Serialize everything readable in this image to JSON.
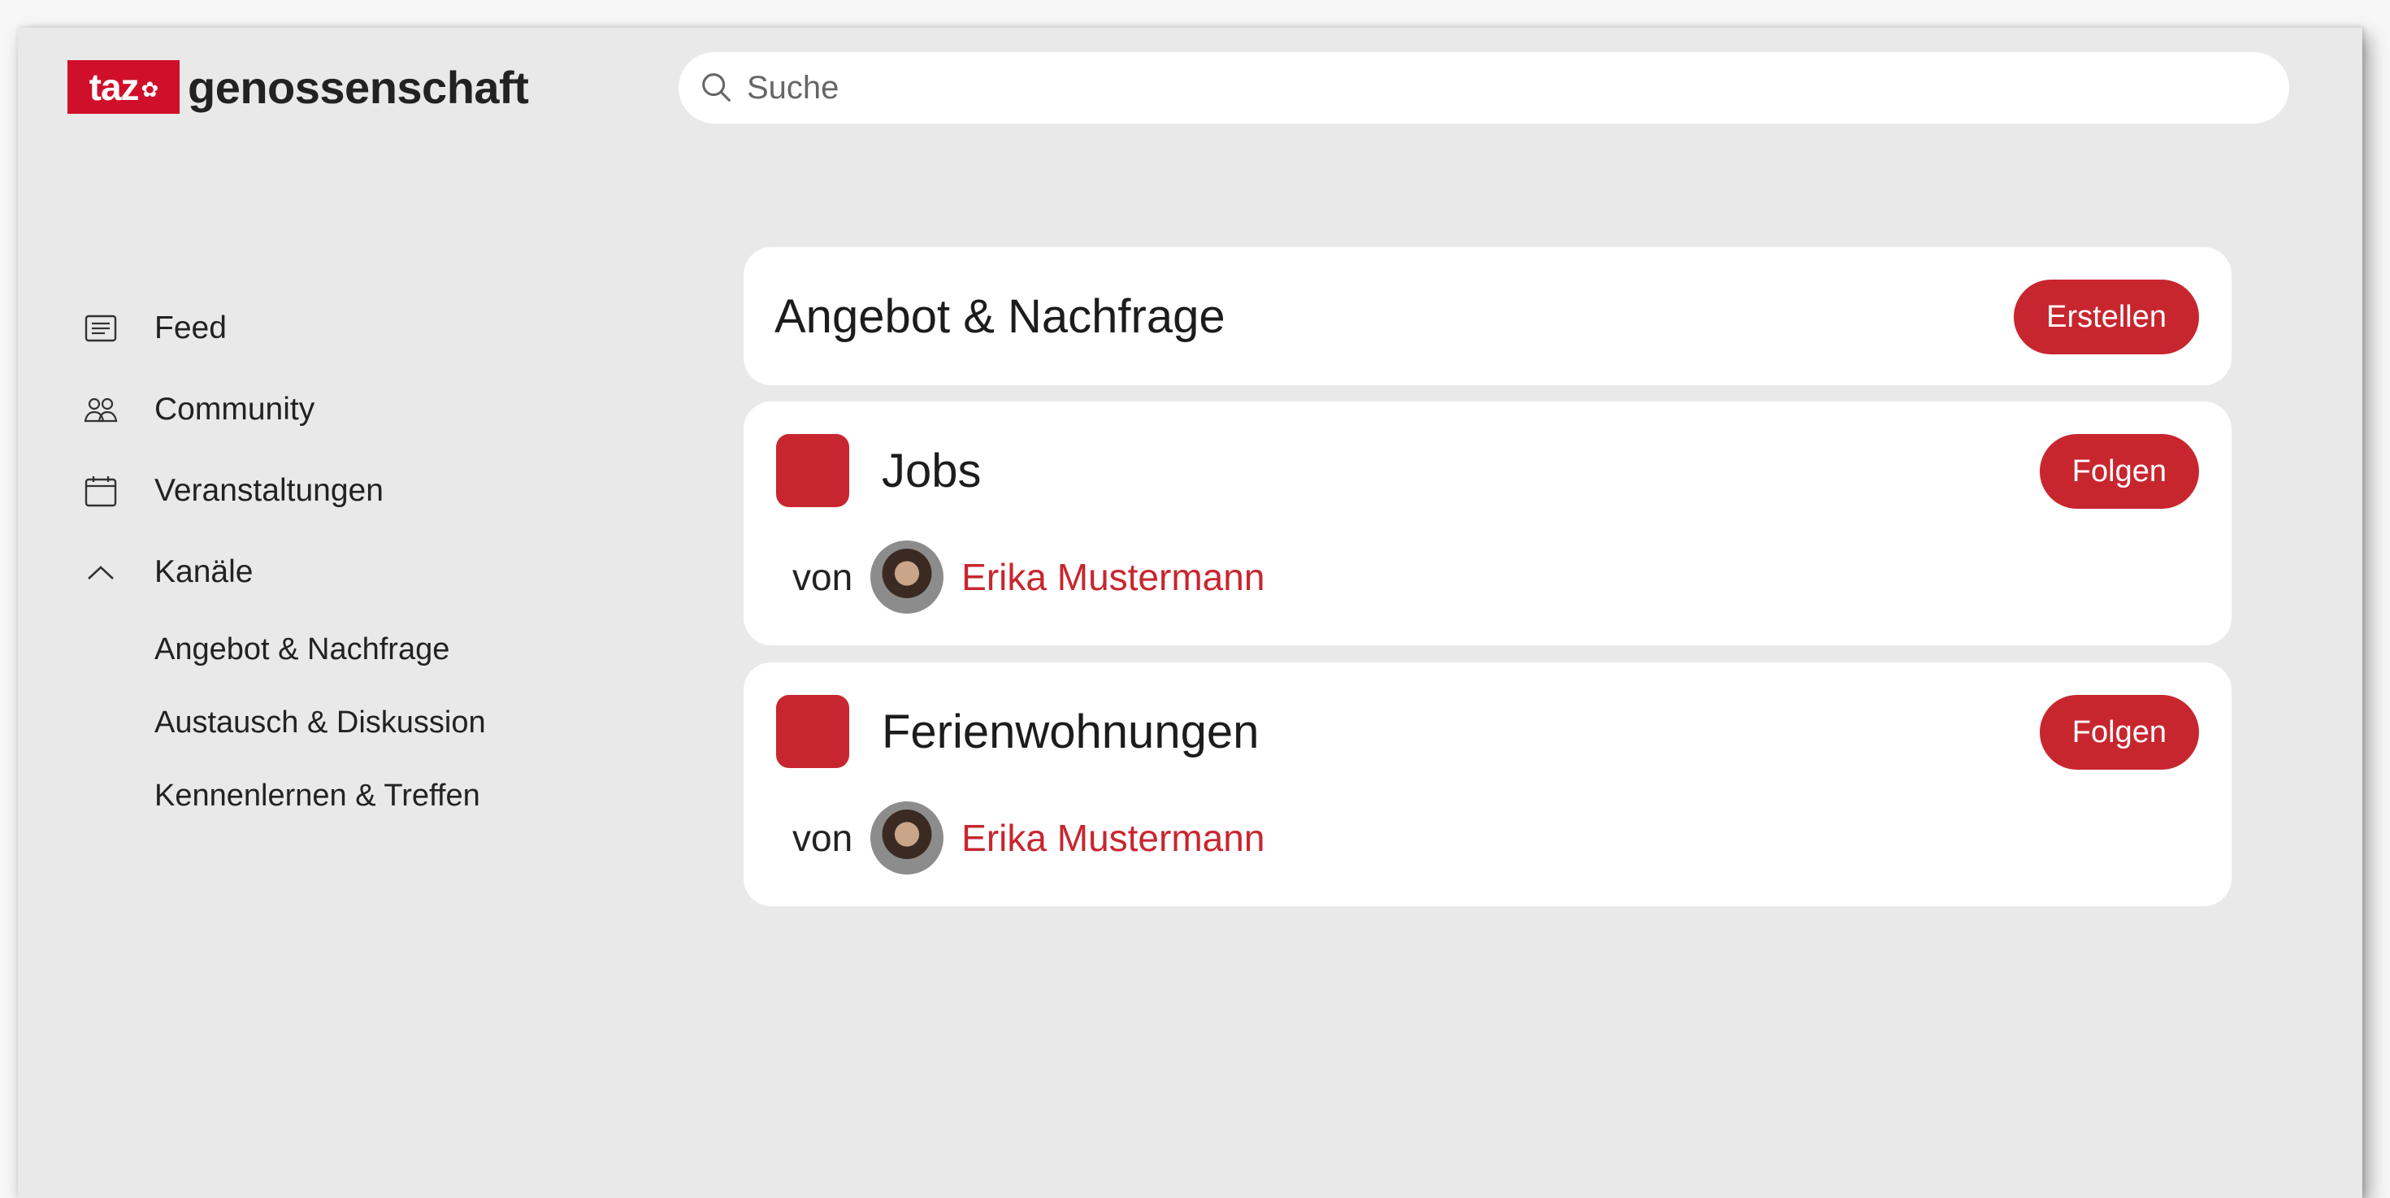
{
  "header": {
    "logo_taz": "taz",
    "logo_word": "genossenschaft",
    "search_placeholder": "Suche"
  },
  "sidebar": {
    "items": [
      {
        "label": "Feed",
        "icon": "feed-icon"
      },
      {
        "label": "Community",
        "icon": "community-icon"
      },
      {
        "label": "Veranstaltungen",
        "icon": "calendar-icon"
      },
      {
        "label": "Kanäle",
        "icon": "chevron-up-icon"
      }
    ],
    "channels": [
      {
        "label": "Angebot & Nachfrage"
      },
      {
        "label": "Austausch & Diskussion"
      },
      {
        "label": "Kennenlernen & Treffen"
      }
    ]
  },
  "main": {
    "title": "Angebot & Nachfrage",
    "create_label": "Erstellen",
    "channels": [
      {
        "name": "Jobs",
        "follow_label": "Folgen",
        "by_prefix": "von",
        "author": "Erika Mustermann"
      },
      {
        "name": "Ferienwohnungen",
        "follow_label": "Folgen",
        "by_prefix": "von",
        "author": "Erika Mustermann"
      }
    ]
  },
  "colors": {
    "accent": "#c8262f",
    "logo_red": "#d0102a",
    "background": "#e9e9e9"
  }
}
